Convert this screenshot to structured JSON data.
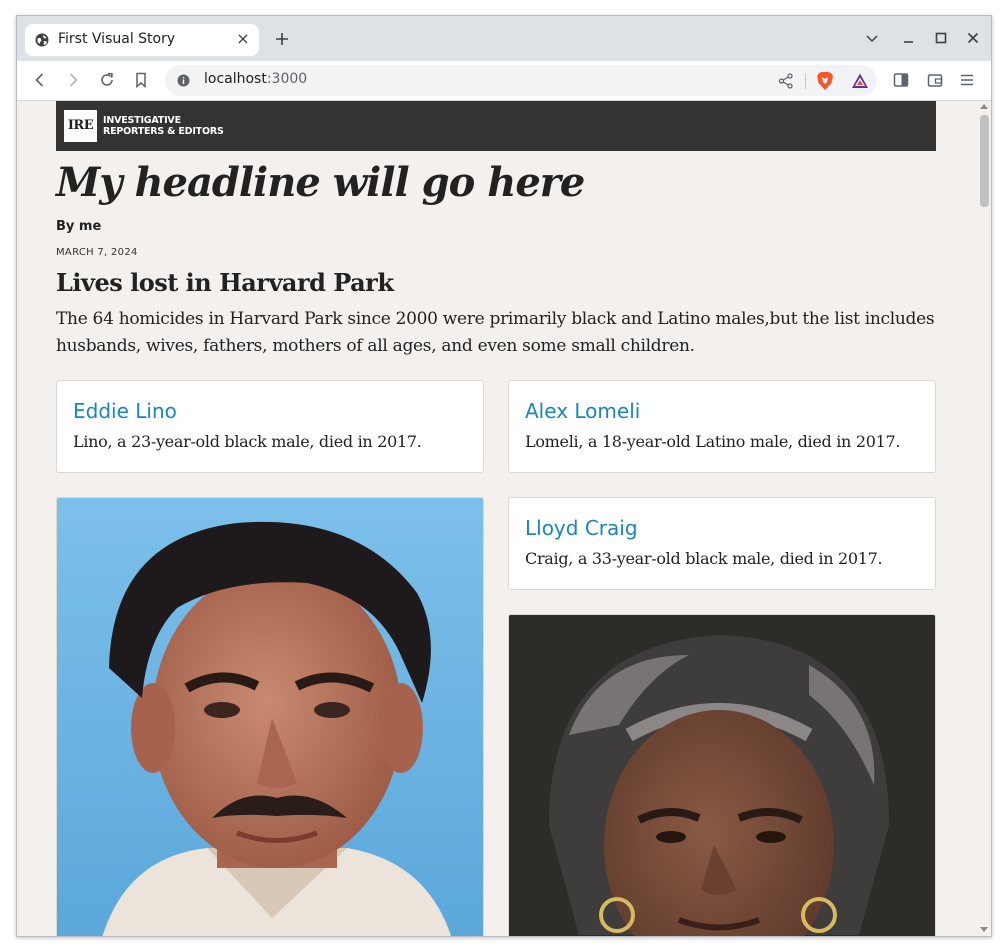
{
  "browser": {
    "tab": {
      "title": "First Visual Story",
      "close_glyph": "×"
    },
    "new_tab_icon": "plus-icon",
    "address_bar": {
      "host": "localhost",
      "port": ":3000"
    },
    "toolbar_icons": [
      "back-icon",
      "forward-icon",
      "reload-icon",
      "bookmark-icon",
      "info-icon",
      "share-icon",
      "brave-shields-icon",
      "brave-rewards-icon",
      "sidebar-icon",
      "wallet-icon",
      "menu-icon"
    ],
    "window_controls": [
      "tab-search-icon",
      "minimize-icon",
      "maximize-icon",
      "close-icon"
    ]
  },
  "page": {
    "logo": {
      "mark": "IRE",
      "line1": "INVESTIGATIVE",
      "line2": "REPORTERS & EDITORS"
    },
    "headline": "My headline will go here",
    "byline": "By me",
    "date": "MARCH 7, 2024",
    "section_title": "Lives lost in Harvard Park",
    "intro": "The 64 homicides in Harvard Park since 2000 were primarily black and Latino males,but the list includes husbands, wives, fathers, mothers of all ages, and even some small children.",
    "victims": [
      {
        "name": "Eddie Lino",
        "description": "Lino, a 23-year-old black male, died in 2017."
      },
      {
        "name": "Alex Lomeli",
        "description": "Lomeli, a 18-year-old Latino male, died in 2017."
      },
      {
        "name": "Lloyd Craig",
        "description": "Craig, a 33-year-old black male, died in 2017."
      }
    ],
    "colors": {
      "link": "#1a85c2",
      "brand_bar": "#333333",
      "page_bg": "#f3f0ed"
    }
  }
}
